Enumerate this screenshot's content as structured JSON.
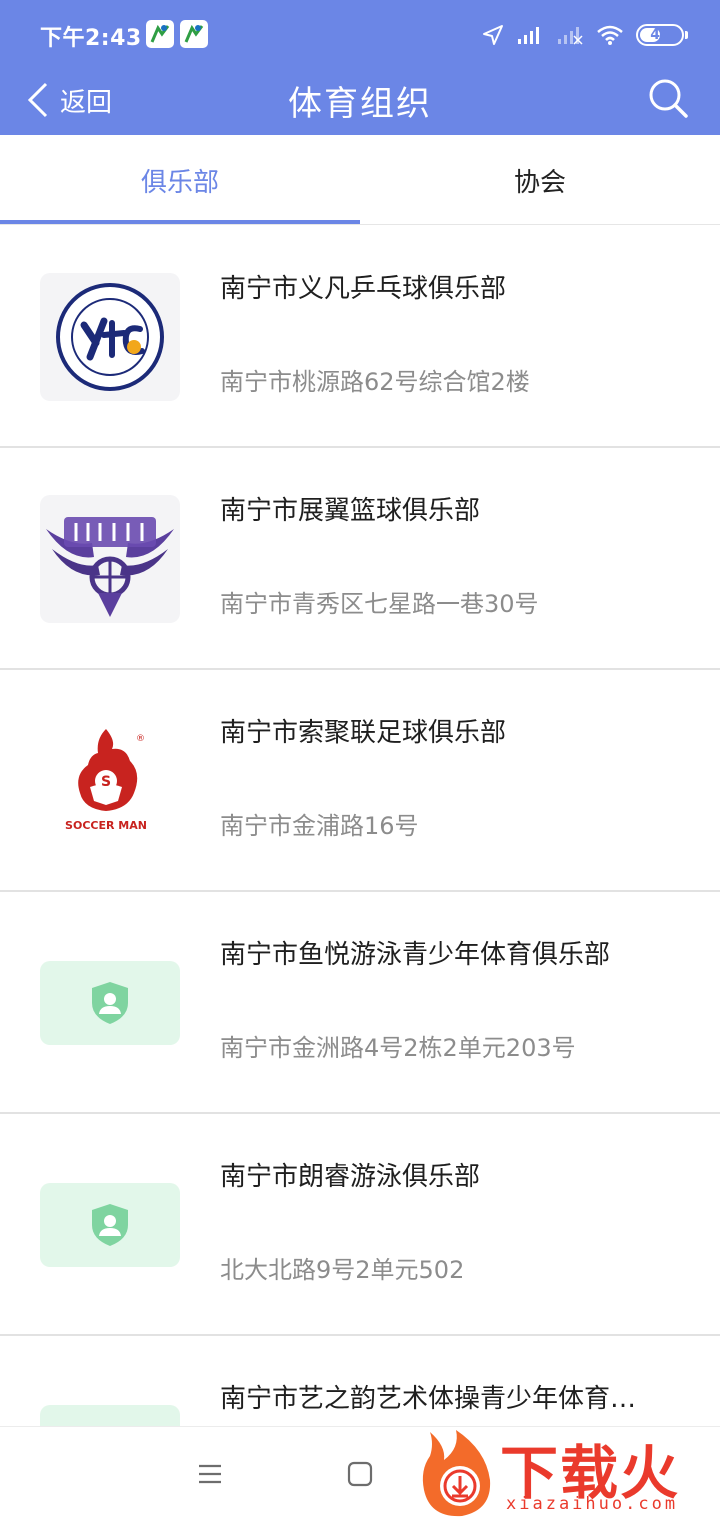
{
  "status_bar": {
    "time": "下午2:43",
    "battery": "49",
    "battery_level": 0.49
  },
  "header": {
    "back_label": "返回",
    "title": "体育组织"
  },
  "tabs": [
    {
      "label": "俱乐部",
      "active": true
    },
    {
      "label": "协会",
      "active": false
    }
  ],
  "clubs": [
    {
      "name": "南宁市义凡乒乓球俱乐部",
      "address": "南宁市桃源路62号综合馆2楼",
      "logo": "yifan-table-tennis-logo"
    },
    {
      "name": "南宁市展翼篮球俱乐部",
      "address": "南宁市青秀区七星路一巷30号",
      "logo": "zhanyi-basketball-logo"
    },
    {
      "name": "南宁市索聚联足球俱乐部",
      "address": "南宁市金浦路16号",
      "logo": "soccer-man-logo",
      "logo_text": "SOCCER MAN"
    },
    {
      "name": "南宁市鱼悦游泳青少年体育俱乐部",
      "address": "南宁市金洲路4号2栋2单元203号",
      "logo": "placeholder-shield-icon"
    },
    {
      "name": "南宁市朗睿游泳俱乐部",
      "address": "北大北路9号2单元502",
      "logo": "placeholder-shield-icon"
    },
    {
      "name": "南宁市艺之韵艺术体操青少年体育…",
      "address": "",
      "logo": "placeholder-shield-icon"
    }
  ],
  "watermark": {
    "text": "下载火",
    "url": "xiazaihuo.com"
  },
  "colors": {
    "primary": "#6b86e6",
    "placeholder_bg": "#e2f7ea",
    "placeholder_icon": "#7fd4a0",
    "watermark": "#ea3a2c"
  }
}
